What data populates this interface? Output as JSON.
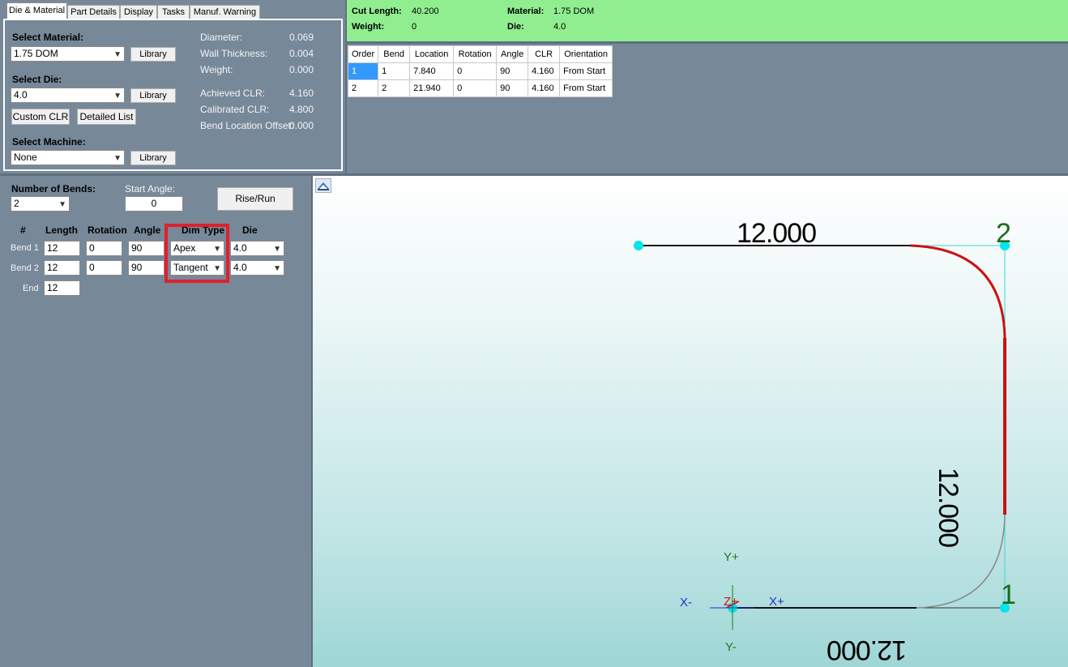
{
  "tabs": [
    "Die & Material",
    "Part Details",
    "Display",
    "Tasks",
    "Manuf. Warning"
  ],
  "material_panel": {
    "select_material_label": "Select Material:",
    "material_value": "1.75 DOM",
    "library_label": "Library",
    "select_die_label": "Select Die:",
    "die_value": "4.0",
    "custom_clr_label": "Custom CLR",
    "detailed_list_label": "Detailed List",
    "select_machine_label": "Select Machine:",
    "machine_value": "None"
  },
  "specs": {
    "diameter_label": "Diameter:",
    "diameter": "0.069",
    "wall_label": "Wall Thickness:",
    "wall": "0.004",
    "weight_label": "Weight:",
    "weight": "0.000",
    "achieved_clr_label": "Achieved CLR:",
    "achieved_clr": "4.160",
    "calibrated_clr_label": "Calibrated CLR:",
    "calibrated_clr": "4.800",
    "offset_label": "Bend Location Offset:",
    "offset": "0.000"
  },
  "summary": {
    "cut_length_label": "Cut Length:",
    "cut_length": "40.200",
    "weight_label": "Weight:",
    "weight": "0",
    "material_label": "Material:",
    "material": "1.75 DOM",
    "die_label": "Die:",
    "die": "4.0"
  },
  "bend_table": {
    "headers": [
      "Order",
      "Bend",
      "Location",
      "Rotation",
      "Angle",
      "CLR",
      "Orientation"
    ],
    "rows": [
      [
        "1",
        "1",
        "7.840",
        "0",
        "90",
        "4.160",
        "From Start"
      ],
      [
        "2",
        "2",
        "21.940",
        "0",
        "90",
        "4.160",
        "From Start"
      ]
    ]
  },
  "bends_panel": {
    "num_bends_label": "Number of Bends:",
    "num_bends": "2",
    "start_angle_label": "Start Angle:",
    "start_angle": "0",
    "rise_run_label": "Rise/Run",
    "col_hash": "#",
    "col_length": "Length",
    "col_rotation": "Rotation",
    "col_angle": "Angle",
    "col_dimtype": "Dim Type",
    "col_die": "Die",
    "rows": [
      {
        "label": "Bend 1",
        "length": "12",
        "rotation": "0",
        "angle": "90",
        "dimtype": "Apex",
        "die": "4.0"
      },
      {
        "label": "Bend 2",
        "length": "12",
        "rotation": "0",
        "angle": "90",
        "dimtype": "Tangent",
        "die": "4.0"
      }
    ],
    "end_label": "End",
    "end_length": "12"
  },
  "view": {
    "dim_top": "12.000",
    "dim_right": "12.000",
    "dim_bottom": "12.000",
    "bend1_marker": "1",
    "bend2_marker": "2",
    "axis_xminus": "X-",
    "axis_xplus": "X+",
    "axis_yplus": "Y+",
    "axis_yminus": "Y-",
    "axis_z": "Z+"
  },
  "colors": {
    "panel": "#778899",
    "summary_bg": "#90ee90",
    "highlight": "#e0202a",
    "bend_red": "#cc1111",
    "node": "#00e5ee"
  }
}
